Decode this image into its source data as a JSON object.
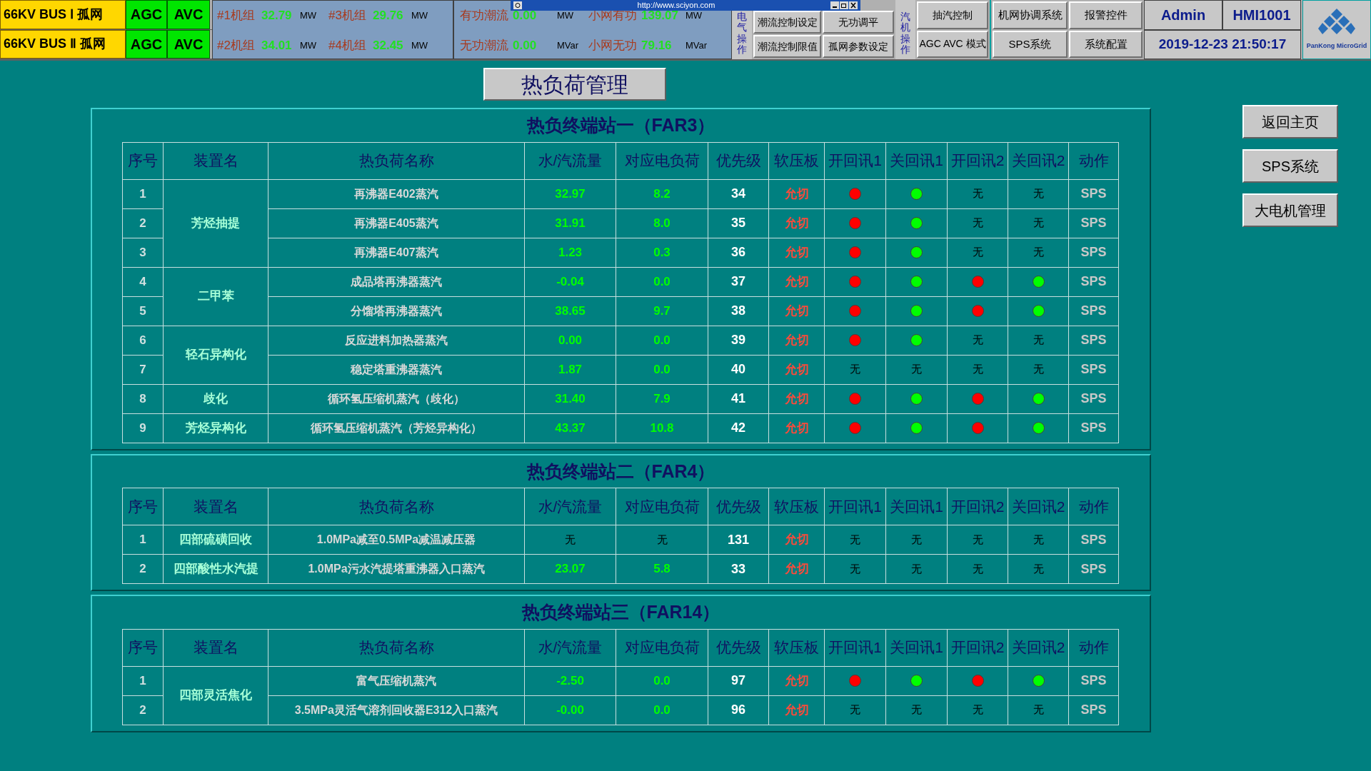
{
  "top_bar": {
    "buses": [
      {
        "label": "66KV BUS Ⅰ 孤网",
        "agc": "AGC",
        "avc": "AVC"
      },
      {
        "label": "66KV BUS Ⅱ 孤网",
        "agc": "AGC",
        "avc": "AVC"
      }
    ],
    "units": [
      [
        {
          "label": "#1机组",
          "value": "32.79",
          "unit": "MW"
        },
        {
          "label": "#3机组",
          "value": "29.76",
          "unit": "MW"
        }
      ],
      [
        {
          "label": "#2机组",
          "value": "34.01",
          "unit": "MW"
        },
        {
          "label": "#4机组",
          "value": "32.45",
          "unit": "MW"
        }
      ]
    ],
    "flows": [
      [
        {
          "label": "有功潮流",
          "value": "0.00",
          "unit": "MW"
        },
        {
          "label": "小网有功",
          "value": "139.07",
          "unit": "MW"
        }
      ],
      [
        {
          "label": "无功潮流",
          "value": "0.00",
          "unit": "MVar"
        },
        {
          "label": "小网无功",
          "value": "79.16",
          "unit": "MVar"
        }
      ]
    ],
    "electrical": {
      "label": "电气操作",
      "buttons": [
        "潮流控制设定",
        "无功调平",
        "潮流控制限值",
        "孤网参数设定"
      ]
    },
    "turbine": {
      "label": "汽机操作",
      "buttons": [
        "抽汽控制",
        "AGC AVC 模式"
      ]
    },
    "system_buttons": [
      "机网协调系统",
      "报警控件",
      "SPS系统",
      "系统配置"
    ],
    "user": "Admin",
    "host": "HMI1001",
    "datetime": "2019-12-23 21:50:17",
    "logo_text": "PanKong MicroGrid"
  },
  "browser_bar": {
    "url": "http://www.sciyon.com"
  },
  "page_title": "热负荷管理",
  "side_buttons": [
    "返回主页",
    "SPS系统",
    "大电机管理"
  ],
  "stations": [
    {
      "title": "热负终端站一（FAR3）",
      "columns": [
        "序号",
        "装置名",
        "热负荷名称",
        "水/汽流量",
        "对应电负荷",
        "优先级",
        "软压板",
        "开回讯1",
        "关回讯1",
        "开回讯2",
        "关回讯2",
        "动作"
      ],
      "groups": [
        {
          "device": "芳烃抽提",
          "rows": [
            {
              "seq": "1",
              "name": "再沸器E402蒸汽",
              "flow": "32.97",
              "load": "8.2",
              "priority": "34",
              "plate": "允切",
              "signals": [
                {
                  "kind": "dot",
                  "color": "#ff0000"
                },
                {
                  "kind": "dot",
                  "color": "#00ff00"
                },
                {
                  "kind": "text",
                  "text": "无"
                },
                {
                  "kind": "text",
                  "text": "无"
                }
              ],
              "action": "SPS"
            },
            {
              "seq": "2",
              "name": "再沸器E405蒸汽",
              "flow": "31.91",
              "load": "8.0",
              "priority": "35",
              "plate": "允切",
              "signals": [
                {
                  "kind": "dot",
                  "color": "#ff0000"
                },
                {
                  "kind": "dot",
                  "color": "#00ff00"
                },
                {
                  "kind": "text",
                  "text": "无"
                },
                {
                  "kind": "text",
                  "text": "无"
                }
              ],
              "action": "SPS"
            },
            {
              "seq": "3",
              "name": "再沸器E407蒸汽",
              "flow": "1.23",
              "load": "0.3",
              "priority": "36",
              "plate": "允切",
              "signals": [
                {
                  "kind": "dot",
                  "color": "#ff0000"
                },
                {
                  "kind": "dot",
                  "color": "#00ff00"
                },
                {
                  "kind": "text",
                  "text": "无"
                },
                {
                  "kind": "text",
                  "text": "无"
                }
              ],
              "action": "SPS"
            }
          ]
        },
        {
          "device": "二甲苯",
          "rows": [
            {
              "seq": "4",
              "name": "成品塔再沸器蒸汽",
              "flow": "-0.04",
              "load": "0.0",
              "priority": "37",
              "plate": "允切",
              "signals": [
                {
                  "kind": "dot",
                  "color": "#ff0000"
                },
                {
                  "kind": "dot",
                  "color": "#00ff00"
                },
                {
                  "kind": "dot",
                  "color": "#ff0000"
                },
                {
                  "kind": "dot",
                  "color": "#00ff00"
                }
              ],
              "action": "SPS"
            },
            {
              "seq": "5",
              "name": "分馏塔再沸器蒸汽",
              "flow": "38.65",
              "load": "9.7",
              "priority": "38",
              "plate": "允切",
              "signals": [
                {
                  "kind": "dot",
                  "color": "#ff0000"
                },
                {
                  "kind": "dot",
                  "color": "#00ff00"
                },
                {
                  "kind": "dot",
                  "color": "#ff0000"
                },
                {
                  "kind": "dot",
                  "color": "#00ff00"
                }
              ],
              "action": "SPS"
            }
          ]
        },
        {
          "device": "轻石异构化",
          "rows": [
            {
              "seq": "6",
              "name": "反应进料加热器蒸汽",
              "flow": "0.00",
              "load": "0.0",
              "priority": "39",
              "plate": "允切",
              "signals": [
                {
                  "kind": "dot",
                  "color": "#ff0000"
                },
                {
                  "kind": "dot",
                  "color": "#00ff00"
                },
                {
                  "kind": "text",
                  "text": "无"
                },
                {
                  "kind": "text",
                  "text": "无"
                }
              ],
              "action": "SPS"
            },
            {
              "seq": "7",
              "name": "稳定塔重沸器蒸汽",
              "flow": "1.87",
              "load": "0.0",
              "priority": "40",
              "plate": "允切",
              "signals": [
                {
                  "kind": "text",
                  "text": "无"
                },
                {
                  "kind": "text",
                  "text": "无"
                },
                {
                  "kind": "text",
                  "text": "无"
                },
                {
                  "kind": "text",
                  "text": "无"
                }
              ],
              "action": "SPS"
            }
          ]
        },
        {
          "device": "歧化",
          "rows": [
            {
              "seq": "8",
              "name": "循环氢压缩机蒸汽（歧化）",
              "flow": "31.40",
              "load": "7.9",
              "priority": "41",
              "plate": "允切",
              "signals": [
                {
                  "kind": "dot",
                  "color": "#ff0000"
                },
                {
                  "kind": "dot",
                  "color": "#00ff00"
                },
                {
                  "kind": "dot",
                  "color": "#ff0000"
                },
                {
                  "kind": "dot",
                  "color": "#00ff00"
                }
              ],
              "action": "SPS"
            }
          ]
        },
        {
          "device": "芳烃异构化",
          "rows": [
            {
              "seq": "9",
              "name": "循环氢压缩机蒸汽（芳烃异构化）",
              "flow": "43.37",
              "load": "10.8",
              "priority": "42",
              "plate": "允切",
              "signals": [
                {
                  "kind": "dot",
                  "color": "#ff0000"
                },
                {
                  "kind": "dot",
                  "color": "#00ff00"
                },
                {
                  "kind": "dot",
                  "color": "#ff0000"
                },
                {
                  "kind": "dot",
                  "color": "#00ff00"
                }
              ],
              "action": "SPS"
            }
          ]
        }
      ]
    },
    {
      "title": "热负终端站二（FAR4）",
      "columns": [
        "序号",
        "装置名",
        "热负荷名称",
        "水/汽流量",
        "对应电负荷",
        "优先级",
        "软压板",
        "开回讯1",
        "关回讯1",
        "开回讯2",
        "关回讯2",
        "动作"
      ],
      "groups": [
        {
          "device": "四部硫磺回收",
          "rows": [
            {
              "seq": "1",
              "name": "1.0MPa减至0.5MPa减温减压器",
              "flow": "无",
              "load": "无",
              "priority": "131",
              "plate": "允切",
              "signals": [
                {
                  "kind": "text",
                  "text": "无"
                },
                {
                  "kind": "text",
                  "text": "无"
                },
                {
                  "kind": "text",
                  "text": "无"
                },
                {
                  "kind": "text",
                  "text": "无"
                }
              ],
              "action": "SPS"
            }
          ]
        },
        {
          "device": "四部酸性水汽提",
          "rows": [
            {
              "seq": "2",
              "name": "1.0MPa污水汽提塔重沸器入口蒸汽",
              "flow": "23.07",
              "load": "5.8",
              "priority": "33",
              "plate": "允切",
              "signals": [
                {
                  "kind": "text",
                  "text": "无"
                },
                {
                  "kind": "text",
                  "text": "无"
                },
                {
                  "kind": "text",
                  "text": "无"
                },
                {
                  "kind": "text",
                  "text": "无"
                }
              ],
              "action": "SPS"
            }
          ]
        }
      ]
    },
    {
      "title": "热负终端站三（FAR14）",
      "columns": [
        "序号",
        "装置名",
        "热负荷名称",
        "水/汽流量",
        "对应电负荷",
        "优先级",
        "软压板",
        "开回讯1",
        "关回讯1",
        "开回讯2",
        "关回讯2",
        "动作"
      ],
      "groups": [
        {
          "device": "四部灵活焦化",
          "rows": [
            {
              "seq": "1",
              "name": "富气压缩机蒸汽",
              "flow": "-2.50",
              "load": "0.0",
              "priority": "97",
              "plate": "允切",
              "signals": [
                {
                  "kind": "dot",
                  "color": "#ff0000"
                },
                {
                  "kind": "dot",
                  "color": "#00ff00"
                },
                {
                  "kind": "dot",
                  "color": "#ff0000"
                },
                {
                  "kind": "dot",
                  "color": "#00ff00"
                }
              ],
              "action": "SPS"
            },
            {
              "seq": "2",
              "name": "3.5MPa灵活气溶剂回收器E312入口蒸汽",
              "flow": "-0.00",
              "load": "0.0",
              "priority": "96",
              "plate": "允切",
              "signals": [
                {
                  "kind": "text",
                  "text": "无"
                },
                {
                  "kind": "text",
                  "text": "无"
                },
                {
                  "kind": "text",
                  "text": "无"
                },
                {
                  "kind": "text",
                  "text": "无"
                }
              ],
              "action": "SPS"
            }
          ]
        }
      ]
    }
  ]
}
